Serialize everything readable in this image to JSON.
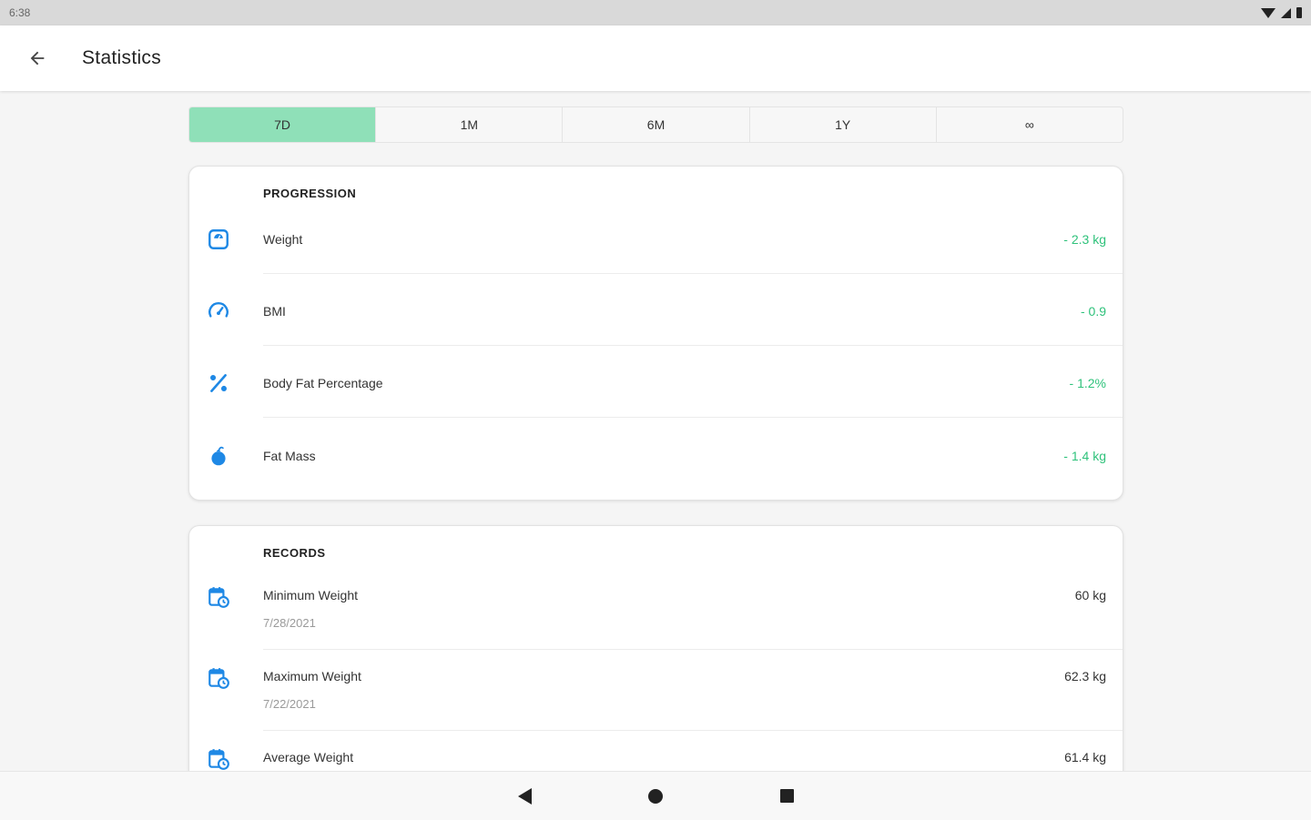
{
  "status_bar": {
    "time": "6:38"
  },
  "app_bar": {
    "title": "Statistics",
    "back_icon": "arrow-back-icon"
  },
  "periods": [
    {
      "label": "7D",
      "active": true
    },
    {
      "label": "1M",
      "active": false
    },
    {
      "label": "6M",
      "active": false
    },
    {
      "label": "1Y",
      "active": false
    },
    {
      "label": "∞",
      "active": false
    }
  ],
  "progression": {
    "header": "PROGRESSION",
    "rows": [
      {
        "label": "Weight",
        "value": "- 2.3 kg",
        "icon": "scale-icon"
      },
      {
        "label": "BMI",
        "value": "- 0.9",
        "icon": "speedometer-icon"
      },
      {
        "label": "Body Fat Percentage",
        "value": "- 1.2%",
        "icon": "percent-icon"
      },
      {
        "label": "Fat Mass",
        "value": "- 1.4 kg",
        "icon": "drop-icon"
      }
    ]
  },
  "records": {
    "header": "RECORDS",
    "rows": [
      {
        "label": "Minimum Weight",
        "date": "7/28/2021",
        "value": "60 kg",
        "icon": "calendar-clock-icon"
      },
      {
        "label": "Maximum Weight",
        "date": "7/22/2021",
        "value": "62.3 kg",
        "icon": "calendar-clock-icon"
      },
      {
        "label": "Average Weight",
        "value": "61.4 kg",
        "icon": "calendar-clock-icon"
      }
    ]
  },
  "colors": {
    "accent_tab": "#8fe0b8",
    "positive": "#2fc27b",
    "icon_blue": "#1e88e5"
  }
}
